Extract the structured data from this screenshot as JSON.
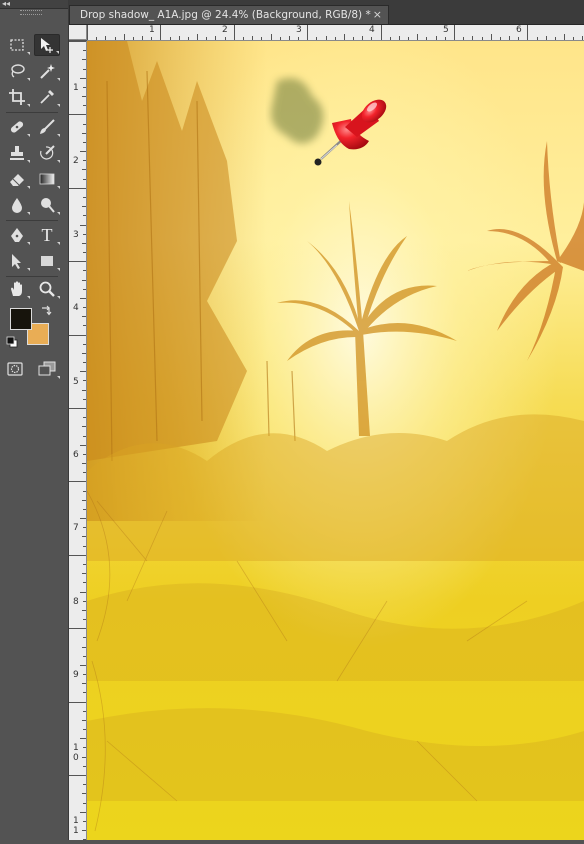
{
  "document": {
    "tab_title": "Drop shadow_ A1A.jpg @ 24.4% (Background, RGB/8) *",
    "close_glyph": "×"
  },
  "toolbox": {
    "collapse_glyph": "◂◂",
    "tools": [
      {
        "name": "rectangular-marquee-tool",
        "icon": "marquee-icon"
      },
      {
        "name": "move-tool",
        "icon": "move-icon",
        "active": true
      },
      {
        "name": "lasso-tool",
        "icon": "lasso-icon"
      },
      {
        "name": "magic-wand-tool",
        "icon": "magic-wand-icon"
      },
      {
        "name": "crop-tool",
        "icon": "crop-icon"
      },
      {
        "name": "eyedropper-tool",
        "icon": "eyedropper-icon"
      },
      {
        "name": "healing-brush-tool",
        "icon": "bandage-icon"
      },
      {
        "name": "brush-tool",
        "icon": "brush-icon"
      },
      {
        "name": "clone-stamp-tool",
        "icon": "stamp-icon"
      },
      {
        "name": "history-brush-tool",
        "icon": "history-brush-icon"
      },
      {
        "name": "eraser-tool",
        "icon": "eraser-icon"
      },
      {
        "name": "gradient-tool",
        "icon": "gradient-icon"
      },
      {
        "name": "blur-tool",
        "icon": "blur-drop-icon"
      },
      {
        "name": "dodge-tool",
        "icon": "dodge-icon"
      },
      {
        "name": "pen-tool",
        "icon": "pen-icon"
      },
      {
        "name": "type-tool",
        "icon": "type-icon",
        "glyph": "T"
      },
      {
        "name": "path-selection-tool",
        "icon": "path-selection-icon"
      },
      {
        "name": "rectangle-shape-tool",
        "icon": "rectangle-icon"
      },
      {
        "name": "hand-tool",
        "icon": "hand-icon"
      },
      {
        "name": "zoom-tool",
        "icon": "zoom-icon"
      },
      {
        "name": "quick-mask-button",
        "icon": "quick-mask-icon"
      },
      {
        "name": "screen-mode-button",
        "icon": "screen-mode-icon"
      }
    ],
    "foreground_color": "#17140c",
    "background_color": "#e9ad55"
  },
  "rulers": {
    "top_labels": [
      "1",
      "2",
      "3",
      "4",
      "5",
      "6"
    ],
    "left_labels": [
      "1",
      "2",
      "3",
      "4",
      "5",
      "6",
      "7",
      "8",
      "9",
      "1\n0",
      "1\n1"
    ],
    "unit": "inches"
  },
  "colors": {
    "panel": "#535353",
    "tab_bar": "#3b3b3b",
    "ruler": "#ececec",
    "canvas_sky": "#fff1a8",
    "canvas_ground": "#f0d21e",
    "pin_red": "#e8141e"
  }
}
